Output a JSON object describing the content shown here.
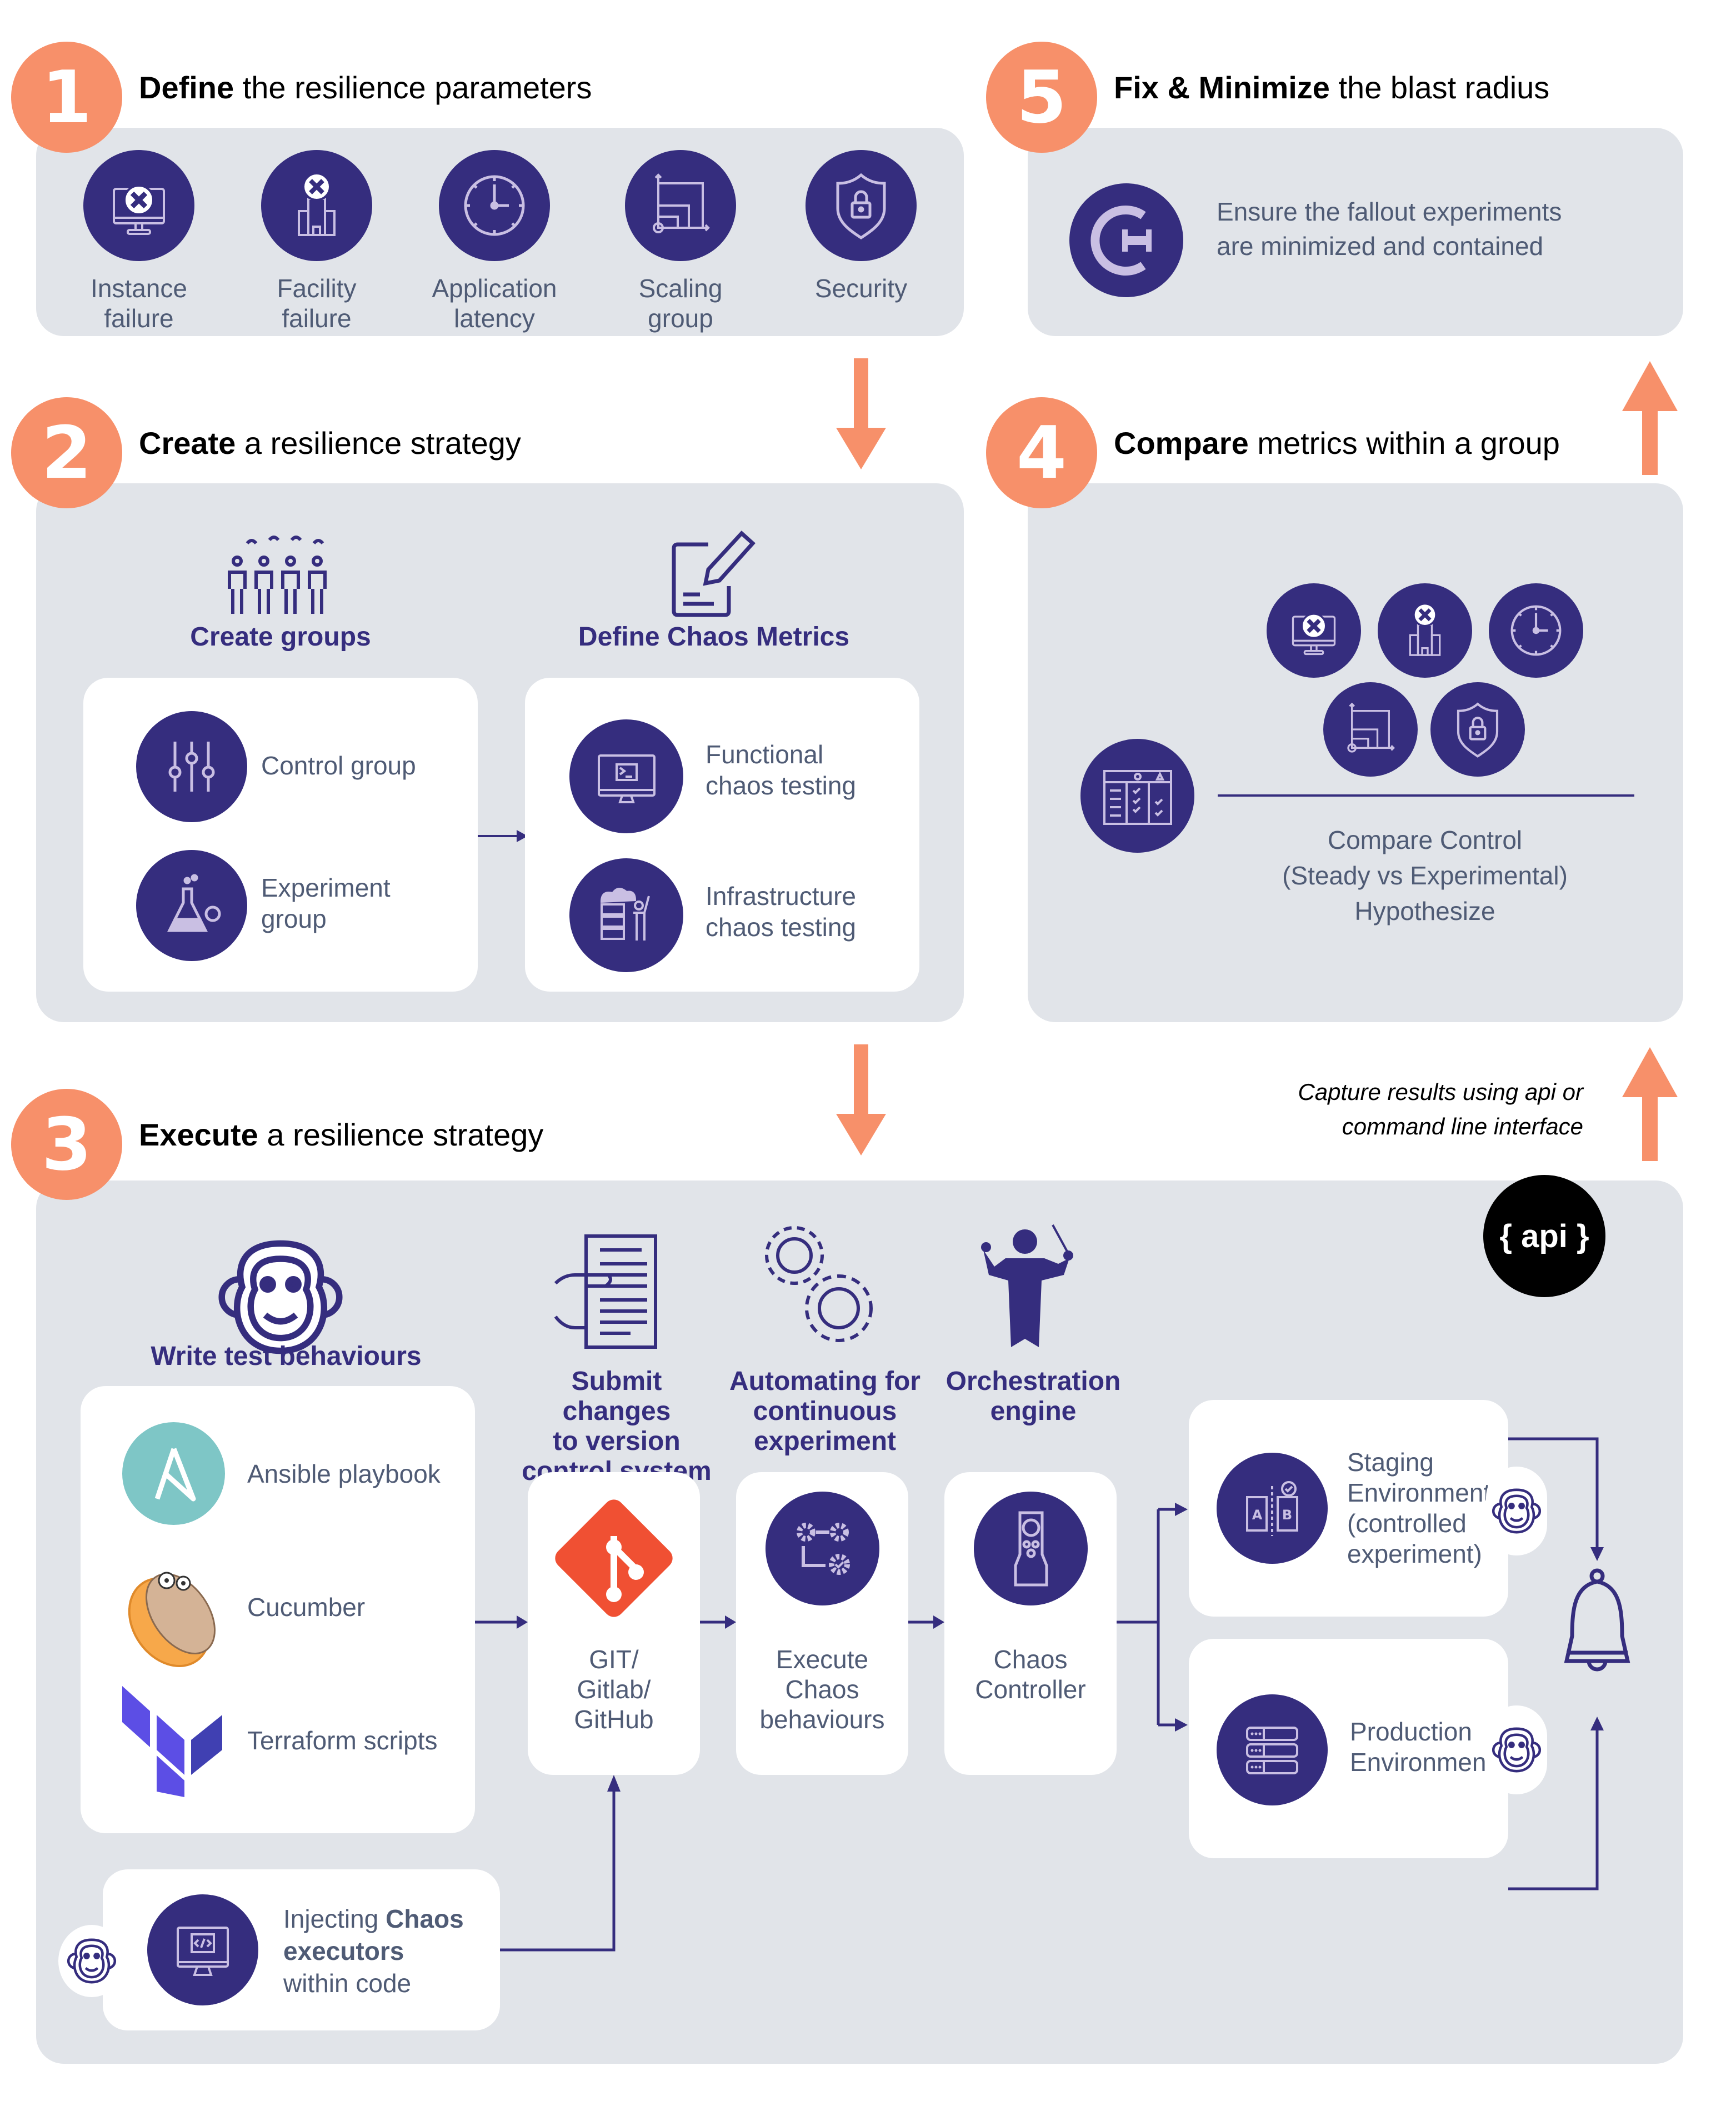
{
  "colors": {
    "accent": "#F7906A",
    "primary": "#352D7E",
    "icon_light": "#C9BFE3",
    "panel": "#E1E4E9",
    "text": "#4F5B75"
  },
  "step1": {
    "number": "1",
    "title_bold": "Define",
    "title_rest": " the resilience parameters",
    "items": [
      {
        "icon": "monitor-failure-icon",
        "line1": "Instance",
        "line2": "failure"
      },
      {
        "icon": "building-failure-icon",
        "line1": "Facility",
        "line2": "failure"
      },
      {
        "icon": "clock-icon",
        "line1": "Application",
        "line2": "latency"
      },
      {
        "icon": "scaling-icon",
        "line1": "Scaling",
        "line2": "group"
      },
      {
        "icon": "shield-lock-icon",
        "line1": "Security",
        "line2": ""
      }
    ]
  },
  "step2": {
    "number": "2",
    "title_bold": "Create",
    "title_rest": " a resilience strategy",
    "groups_heading": "Create groups",
    "metrics_heading": "Define Chaos Metrics",
    "groups": [
      {
        "icon": "sliders-icon",
        "line1": "Control group",
        "line2": ""
      },
      {
        "icon": "flask-gear-icon",
        "line1": "Experiment",
        "line2": "group"
      }
    ],
    "metrics": [
      {
        "icon": "terminal-monitor-icon",
        "line1": "Functional",
        "line2": "chaos testing"
      },
      {
        "icon": "server-person-icon",
        "line1": "Infrastructure",
        "line2": "chaos testing"
      }
    ]
  },
  "step3": {
    "number": "3",
    "title_bold": "Execute",
    "title_rest": " a resilience strategy",
    "write_heading": "Write test behaviours",
    "tools": [
      {
        "icon": "ansible-icon",
        "label": "Ansible playbook"
      },
      {
        "icon": "cucumber-gopher-icon",
        "label": "Cucumber"
      },
      {
        "icon": "terraform-icon",
        "label": "Terraform scripts"
      }
    ],
    "inject": {
      "pre": "Injecting ",
      "bold1": "Chaos",
      "bold2": "executors",
      "post": "within code"
    },
    "columns": [
      {
        "heading1": "Submit changes",
        "heading2": "to version",
        "heading3": "control system",
        "label1": "GIT/",
        "label2": "Gitlab/",
        "label3": "GitHub"
      },
      {
        "heading1": "Automating for",
        "heading2": "continuous",
        "heading3": "experiment",
        "label1": "Execute",
        "label2": "Chaos",
        "label3": "behaviours"
      },
      {
        "heading1": "Orchestration",
        "heading2": "engine",
        "heading3": "",
        "label1": "Chaos",
        "label2": "Controller",
        "label3": ""
      }
    ],
    "envs": [
      {
        "line1": "Staging",
        "line2": "Environment",
        "line3": "(controlled",
        "line4": "experiment)"
      },
      {
        "line1": "Production",
        "line2": "Environment",
        "line3": "",
        "line4": ""
      }
    ],
    "api_badge": "{ api }",
    "capture_line1": "Capture results using api or",
    "capture_line2": "command line interface"
  },
  "step4": {
    "number": "4",
    "title_bold": "Compare",
    "title_rest": " metrics within a group",
    "line1": "Compare Control",
    "line2": "(Steady vs Experimental)",
    "line3": "Hypothesize"
  },
  "step5": {
    "number": "5",
    "title_bold": "Fix & Minimize",
    "title_rest": " the blast radius",
    "line1": "Ensure the fallout experiments",
    "line2": "are minimized and contained"
  }
}
